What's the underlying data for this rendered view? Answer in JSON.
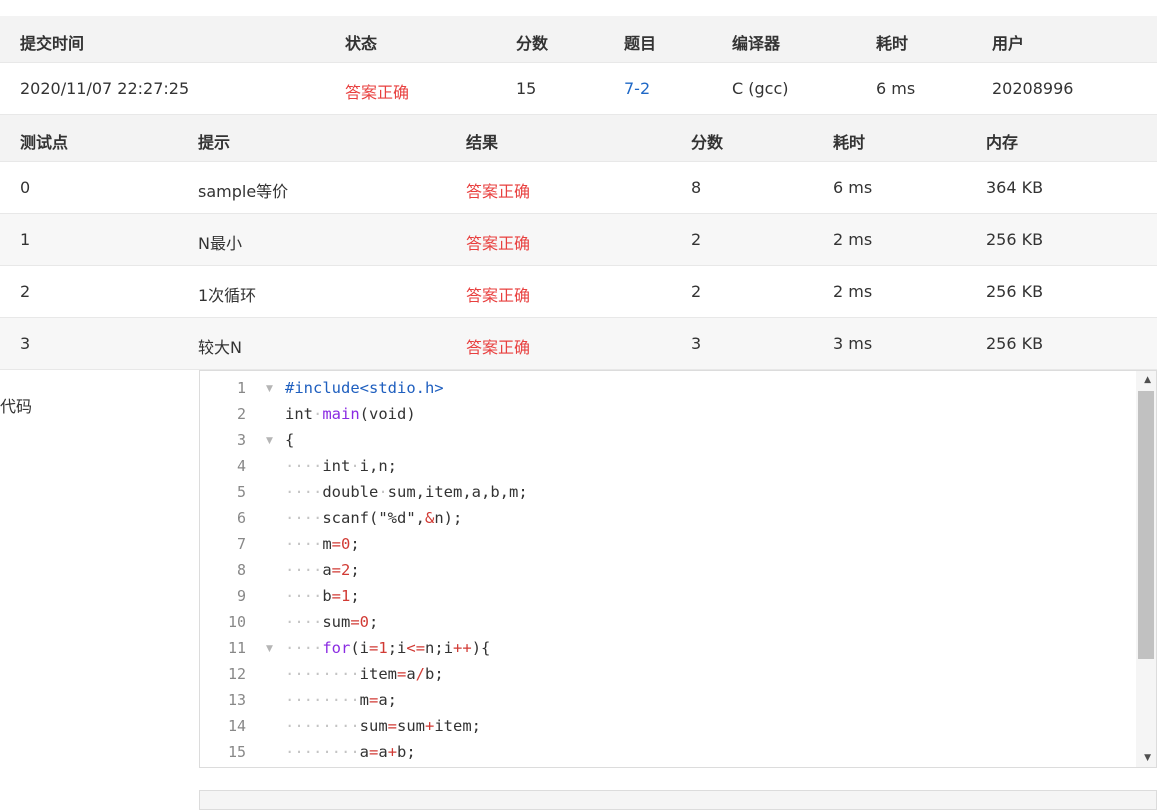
{
  "submission": {
    "headers": [
      "提交时间",
      "状态",
      "分数",
      "题目",
      "编译器",
      "耗时",
      "用户"
    ],
    "time": "2020/11/07 22:27:25",
    "status": "答案正确",
    "score": "15",
    "problem": "7-2",
    "compiler": "C (gcc)",
    "elapsed": "6 ms",
    "user": "20208996"
  },
  "testcases": {
    "headers": [
      "测试点",
      "提示",
      "结果",
      "分数",
      "耗时",
      "内存"
    ],
    "rows": [
      {
        "id": "0",
        "hint": "sample等价",
        "result": "答案正确",
        "score": "8",
        "time": "6 ms",
        "memory": "364 KB"
      },
      {
        "id": "1",
        "hint": "N最小",
        "result": "答案正确",
        "score": "2",
        "time": "2 ms",
        "memory": "256 KB"
      },
      {
        "id": "2",
        "hint": "1次循环",
        "result": "答案正确",
        "score": "2",
        "time": "2 ms",
        "memory": "256 KB"
      },
      {
        "id": "3",
        "hint": "较大N",
        "result": "答案正确",
        "score": "3",
        "time": "3 ms",
        "memory": "256 KB"
      }
    ]
  },
  "code": {
    "label": "代码",
    "lines": [
      "#include<stdio.h>",
      "int main(void)",
      "{",
      "    int i,n;",
      "    double sum,item,a,b,m;",
      "    scanf(\"%d\",&n);",
      "    m=0;",
      "    a=2;",
      "    b=1;",
      "    sum=0;",
      "    for(i=1;i<=n;i++){",
      "        item=a/b;",
      "        m=a;",
      "        sum=sum+item;",
      "        a=a+b;"
    ],
    "fold_lines": [
      1,
      3,
      11
    ]
  }
}
